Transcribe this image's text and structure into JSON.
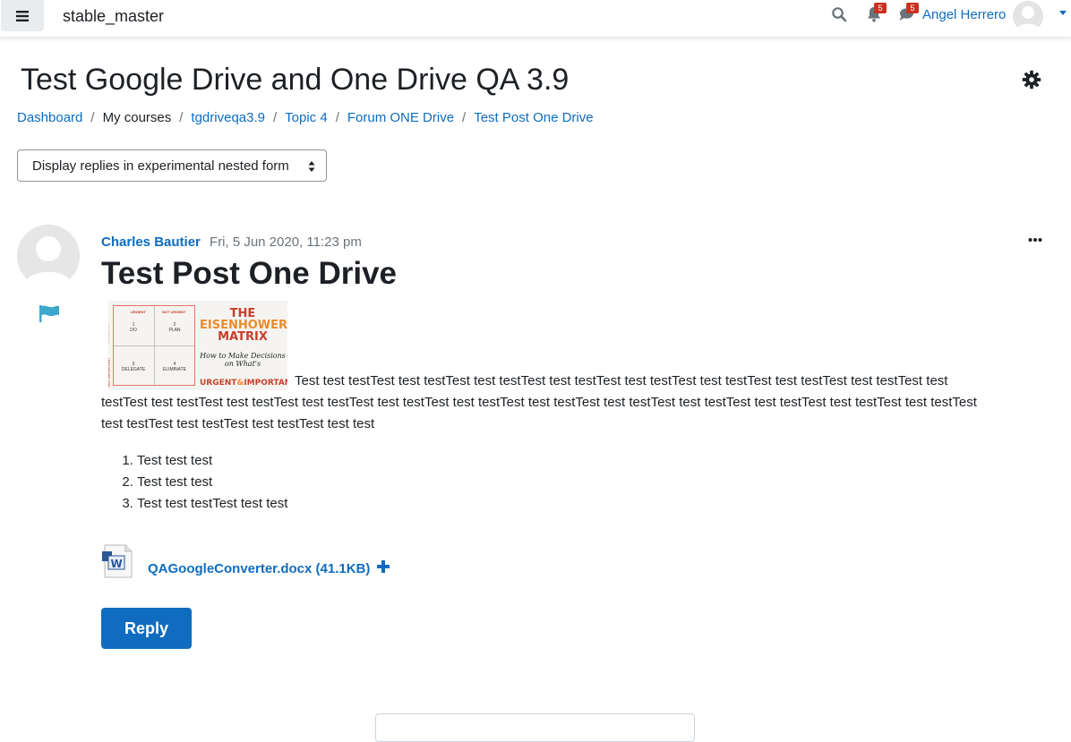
{
  "navbar": {
    "site_name": "stable_master",
    "notifications_count": "5",
    "messages_count": "5",
    "user_name": "Angel Herrero"
  },
  "page": {
    "title": "Test Google Drive and One Drive QA 3.9"
  },
  "breadcrumb": {
    "items": [
      "Dashboard",
      "My courses",
      "tgdriveqa3.9",
      "Topic 4",
      "Forum ONE Drive",
      "Test Post One Drive"
    ],
    "separator": "/"
  },
  "display_mode": {
    "selected": "Display replies in experimental nested form"
  },
  "post": {
    "author": "Charles Bautier",
    "date": "Fri, 5 Jun 2020, 11:23 pm",
    "subject": "Test Post One Drive",
    "image": {
      "label_urgent": "URGENT",
      "label_not_urgent": "NOT URGENT",
      "label_important": "IMPORTANT",
      "label_not_important": "NOT IMPORTANT",
      "q1_num": "1",
      "q1": "DO",
      "q2_num": "2",
      "q2": "PLAN",
      "q3_num": "3",
      "q3": "DELEGATE",
      "q4_num": "4",
      "q4": "ELIMINATE",
      "title_1": "THE",
      "title_2": "EISENHOWER",
      "title_3": "MATRIX",
      "subtitle": "How to Make Decisions on What's",
      "urgent": "URGENT",
      "amp": "&",
      "important": "IMPORTANT"
    },
    "body": "Test test testTest test testTest test testTest test testTest test testTest test testTest test testTest test testTest test testTest test testTest test testTest test testTest test testTest test testTest test testTest test testTest test testTest test testTest test testTest test testTest test testTest test testTest test testTest test test",
    "list": [
      "Test test test",
      "Test test test",
      "Test test testTest test test"
    ],
    "attachment": {
      "file_name": "QAGoogleConverter.docx (41.1KB)",
      "icon_letter": "W"
    },
    "reply_label": "Reply"
  },
  "colors": {
    "link": "#0f6cbf",
    "text": "#1d2125",
    "muted": "#6a737b",
    "badge": "#ca3120"
  }
}
